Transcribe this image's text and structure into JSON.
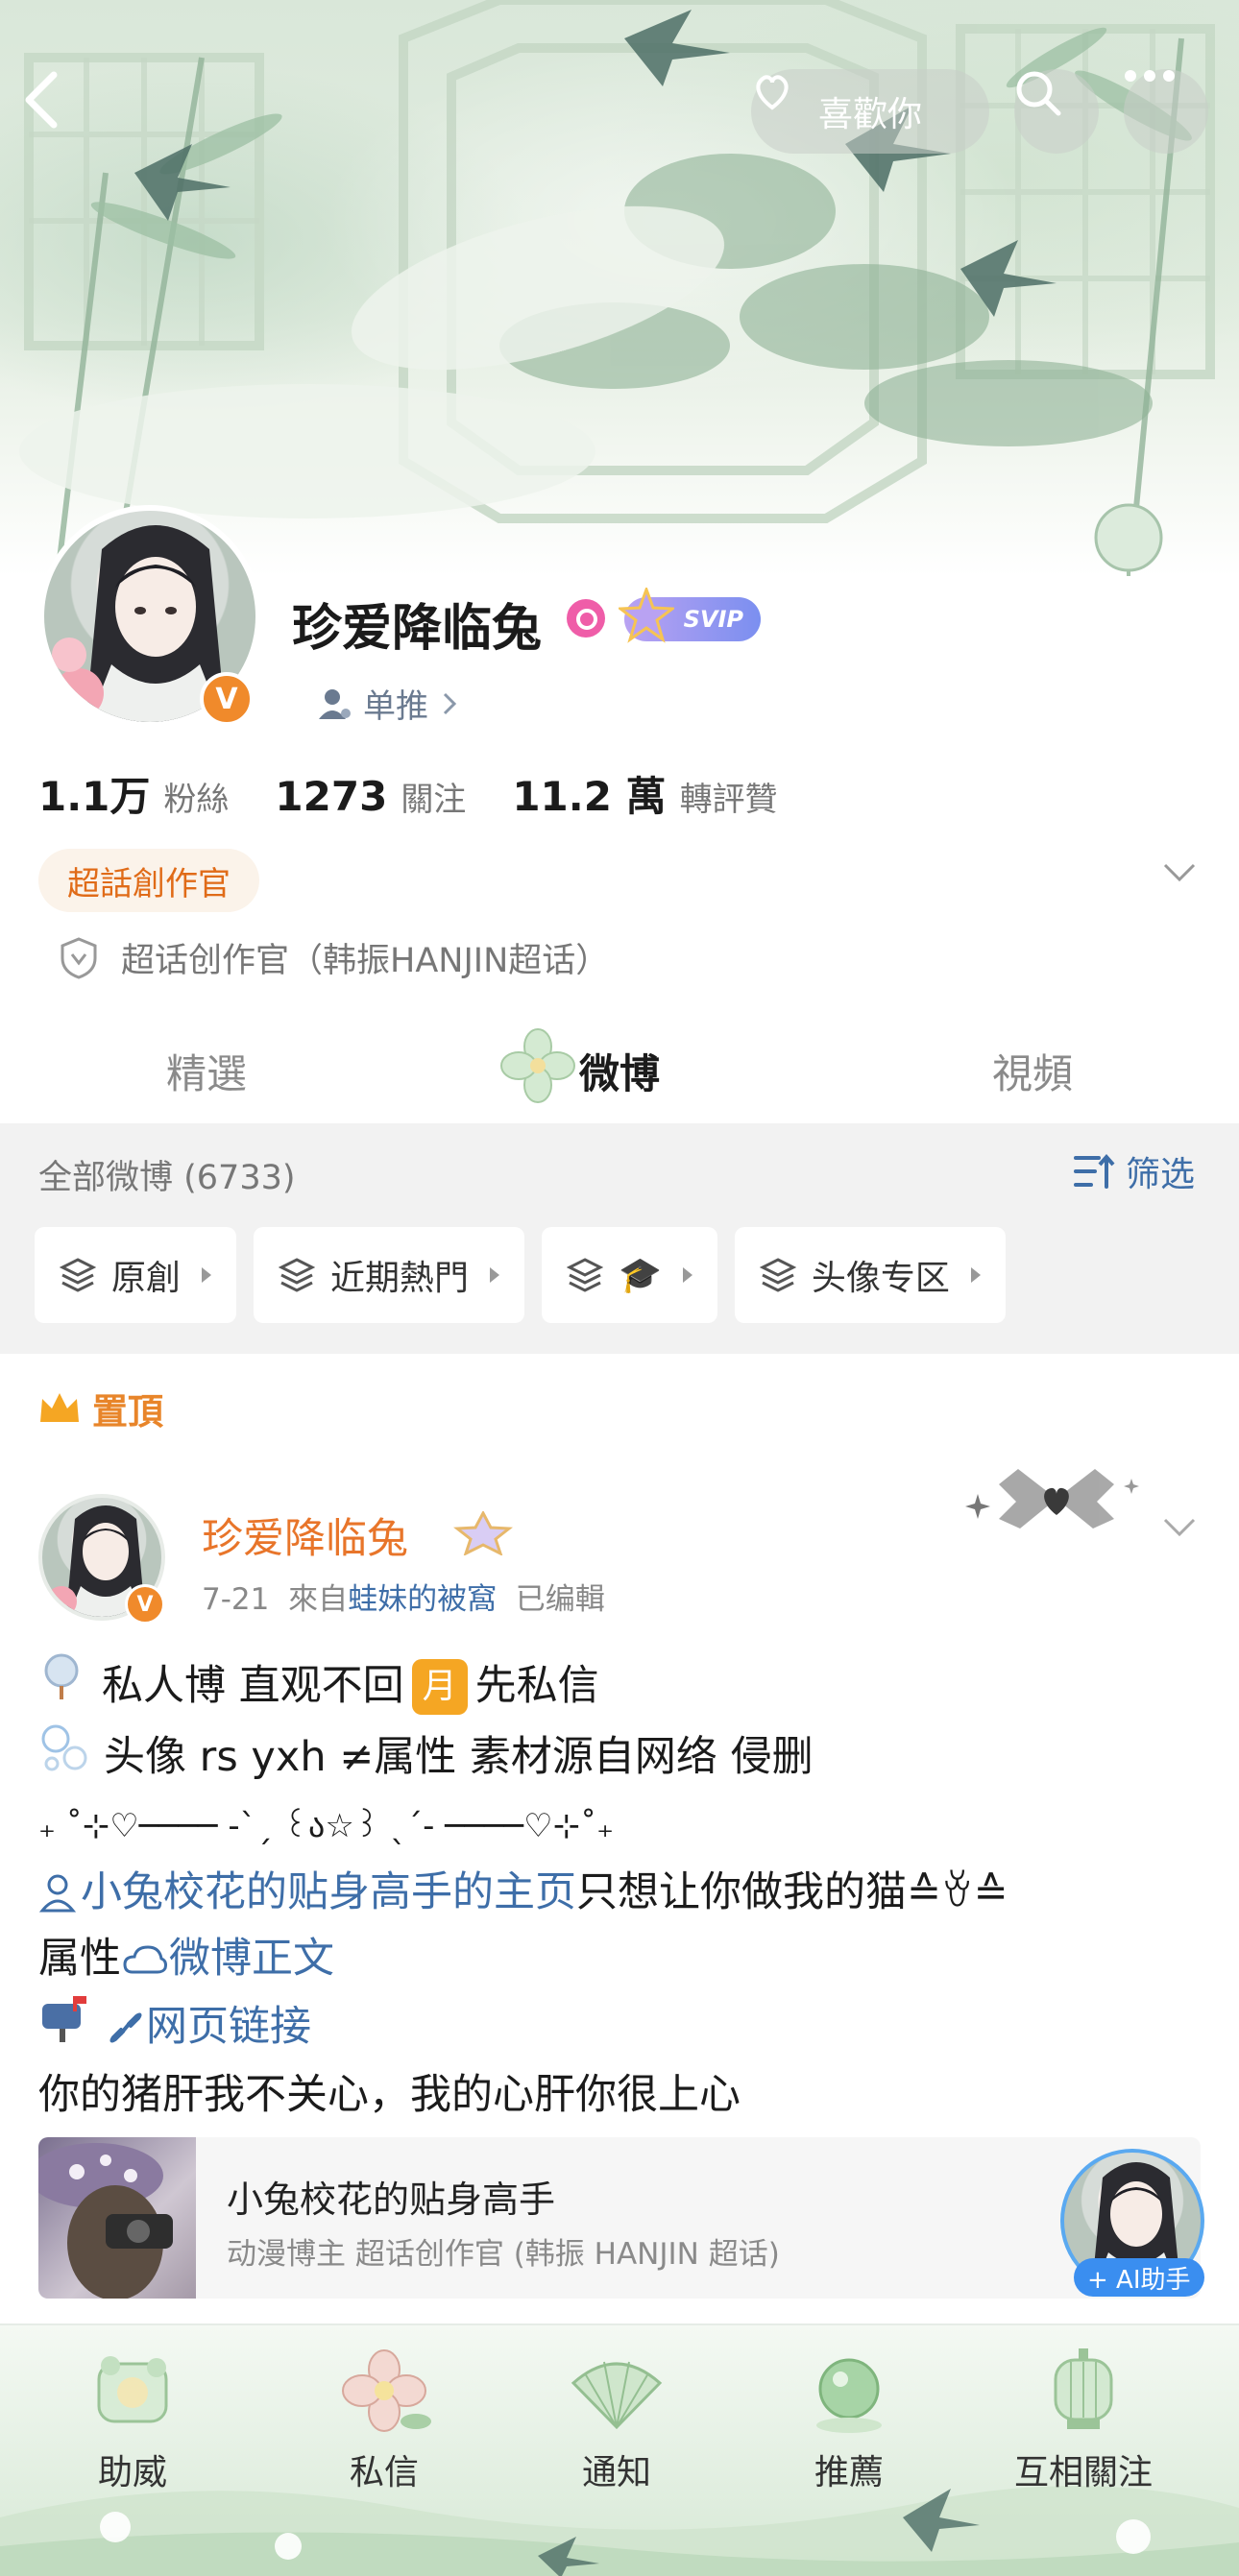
{
  "header": {
    "like_label": "喜歡你",
    "icons": [
      "back-icon",
      "heart-hand-icon",
      "search-icon",
      "more-icon"
    ]
  },
  "profile": {
    "name": "珍爱降临兔",
    "vip_label": "SVIP",
    "single_push": "单推",
    "verified_mark": "V",
    "stats": [
      {
        "value": "1.1万",
        "label": "粉絲"
      },
      {
        "value": "1273",
        "label": "關注"
      },
      {
        "value": "11.2 萬",
        "label": "轉評贊"
      }
    ],
    "creator_tag": "超話創作官",
    "verify_text": "超话创作官（韩振HANJIN超话）"
  },
  "tabs": [
    {
      "label": "精選",
      "active": false
    },
    {
      "label": "微博",
      "active": true
    },
    {
      "label": "視頻",
      "active": false
    }
  ],
  "filter": {
    "title": "全部微博 (6733)",
    "filter_label": "筛选",
    "chips": [
      {
        "label": "原創"
      },
      {
        "label": "近期熱門"
      },
      {
        "label": "🎓"
      },
      {
        "label": "头像专区"
      }
    ]
  },
  "post": {
    "pinned_label": "置頂",
    "author": "珍爱降临兔",
    "date": "7-21",
    "from_prefix": "來自",
    "source": "蛙妹的被窩",
    "edited": "已编輯",
    "lines": {
      "l1a": "私人博 直观不回",
      "l1moon": "月",
      "l1b": "先私信",
      "l2": "头像 rs yxh ≠属性 素材源自网络 侵删",
      "l3": "₊ ˚⊹♡──── -ˋˏ ꒰ა☆꒱ ˎˊ- ────♡⊹˚₊",
      "l4link": "小兔校花的贴身高手的主页",
      "l4b": "只想让你做我的猫≙ꈊ≙",
      "l5a": "属性",
      "l5link": "微博正文",
      "l6link": "网页链接",
      "l7": "你的猪肝我不关心，我的心肝你很上心"
    },
    "card": {
      "title": "小兔校花的贴身高手",
      "subtitle": "动漫博主 超话创作官 (韩振 HANJIN 超话)",
      "ai_label": "+ AI助手"
    }
  },
  "bottom_nav": [
    {
      "label": "助威"
    },
    {
      "label": "私信"
    },
    {
      "label": "通知"
    },
    {
      "label": "推薦"
    },
    {
      "label": "互相關注"
    }
  ],
  "colors": {
    "accent_orange": "#e8752a",
    "link_blue": "#3e6ea8",
    "verified_orange": "#f08a2b",
    "svip_purple": "#7b8ff0"
  }
}
